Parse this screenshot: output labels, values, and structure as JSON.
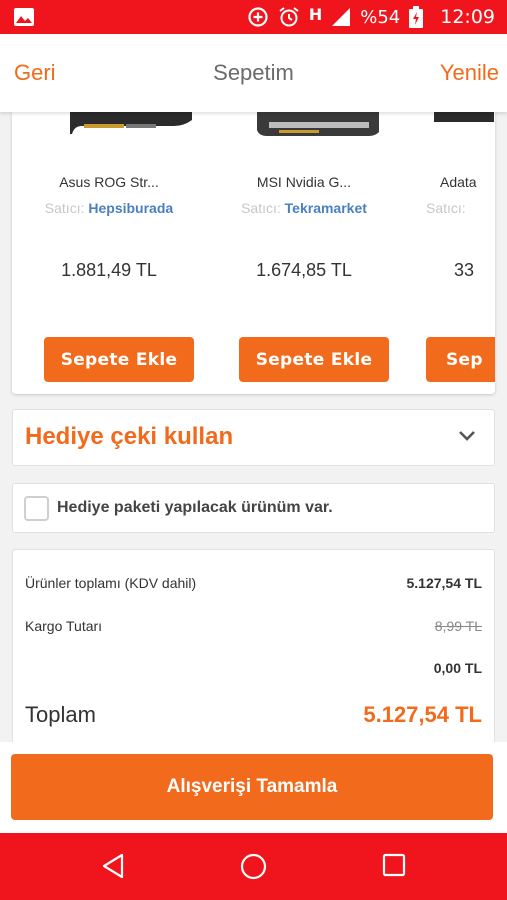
{
  "status_bar": {
    "signal_type": "H",
    "battery": "%54",
    "time": "12:09",
    "icons": [
      "image-icon",
      "data-saver-icon",
      "alarm-icon",
      "signal-icon",
      "battery-charging-icon"
    ]
  },
  "header": {
    "back_label": "Geri",
    "title": "Sepetim",
    "refresh_label": "Yenile"
  },
  "recommendations": {
    "products": [
      {
        "name": "Asus ROG Str...",
        "seller_label": "Satıcı:",
        "seller": "Hepsiburada",
        "price": "1.881,49 TL",
        "button": "Sepete Ekle"
      },
      {
        "name": "MSI Nvidia G...",
        "seller_label": "Satıcı:",
        "seller": "Tekramarket",
        "price": "1.674,85 TL",
        "button": "Sepete Ekle"
      },
      {
        "name": "Adata",
        "seller_label": "Satıcı:",
        "seller": "",
        "price": "33",
        "button": "Sep"
      }
    ]
  },
  "gift_voucher": {
    "label": "Hediye çeki kullan"
  },
  "gift_package": {
    "label": "Hediye paketi yapılacak ürünüm var.",
    "checked": false
  },
  "summary": {
    "subtotal_label": "Ürünler toplamı (KDV dahil)",
    "subtotal_value": "5.127,54 TL",
    "shipping_label": "Kargo Tutarı",
    "shipping_old": "8,99 TL",
    "shipping_value": "0,00 TL",
    "total_label": "Toplam",
    "total_value": "5.127,54 TL"
  },
  "checkout": {
    "label": "Alışverişi Tamamla"
  },
  "colors": {
    "accent": "#f26a1b",
    "status_bar": "#f0151d",
    "link": "#4a7fc1"
  }
}
